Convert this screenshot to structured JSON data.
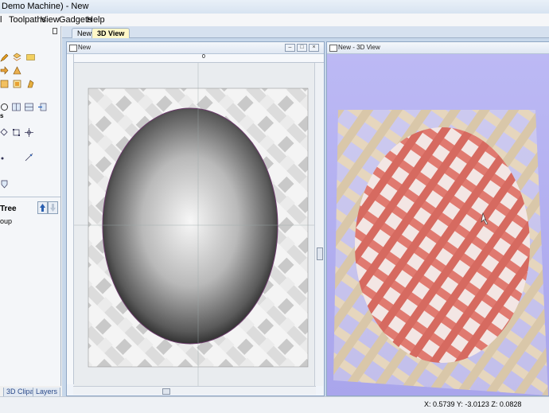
{
  "app": {
    "title": "Demo Machine) - New"
  },
  "menu": {
    "items": [
      "l",
      "Toolpaths",
      "View",
      "Gadgets",
      "Help"
    ]
  },
  "left_panel": {
    "tree_label": "Tree",
    "group_label": "oup",
    "bottom_tabs": [
      "3D Clipart",
      "Layers"
    ]
  },
  "tabs": [
    {
      "label": "New",
      "active": false
    },
    {
      "label": "3D View",
      "active": true
    }
  ],
  "view2d": {
    "title": "New",
    "ruler_zero": "0"
  },
  "view3d": {
    "title": "New - 3D View"
  },
  "status": {
    "coords": "X: 0.5739 Y: -3.0123 Z: 0.0828"
  },
  "colors": {
    "accent_tab": "#fff7c8",
    "view3d_bg": "#b5b2f0",
    "weave_light": "#e6d6bd",
    "weave_red": "#e07a70"
  }
}
